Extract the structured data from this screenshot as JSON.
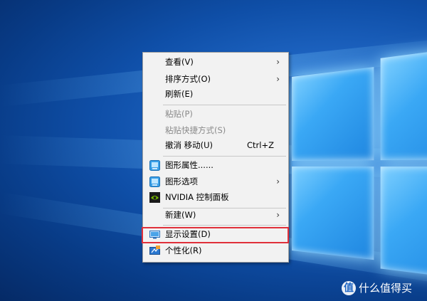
{
  "menu": {
    "items": [
      {
        "label": "查看(V)",
        "arrow": "›"
      },
      {
        "label": "排序方式(O)",
        "arrow": "›"
      },
      {
        "label": "刷新(E)"
      },
      {
        "label": "粘贴(P)"
      },
      {
        "label": "粘贴快捷方式(S)"
      },
      {
        "label": "撤消 移动(U)",
        "shortcut": "Ctrl+Z"
      },
      {
        "label": "图形属性......",
        "icon": "intel-graphics-icon"
      },
      {
        "label": "图形选项",
        "arrow": "›",
        "icon": "intel-graphics-icon"
      },
      {
        "label": "NVIDIA 控制面板",
        "icon": "nvidia-icon"
      },
      {
        "label": "新建(W)",
        "arrow": "›"
      },
      {
        "label": "显示设置(D)",
        "icon": "display-icon"
      },
      {
        "label": "个性化(R)",
        "icon": "personalize-icon"
      }
    ]
  },
  "watermark": {
    "badge": "值",
    "text": "什么值得买"
  },
  "colors": {
    "highlight": "#e0303a",
    "desktop_blue": "#1f66c4"
  }
}
